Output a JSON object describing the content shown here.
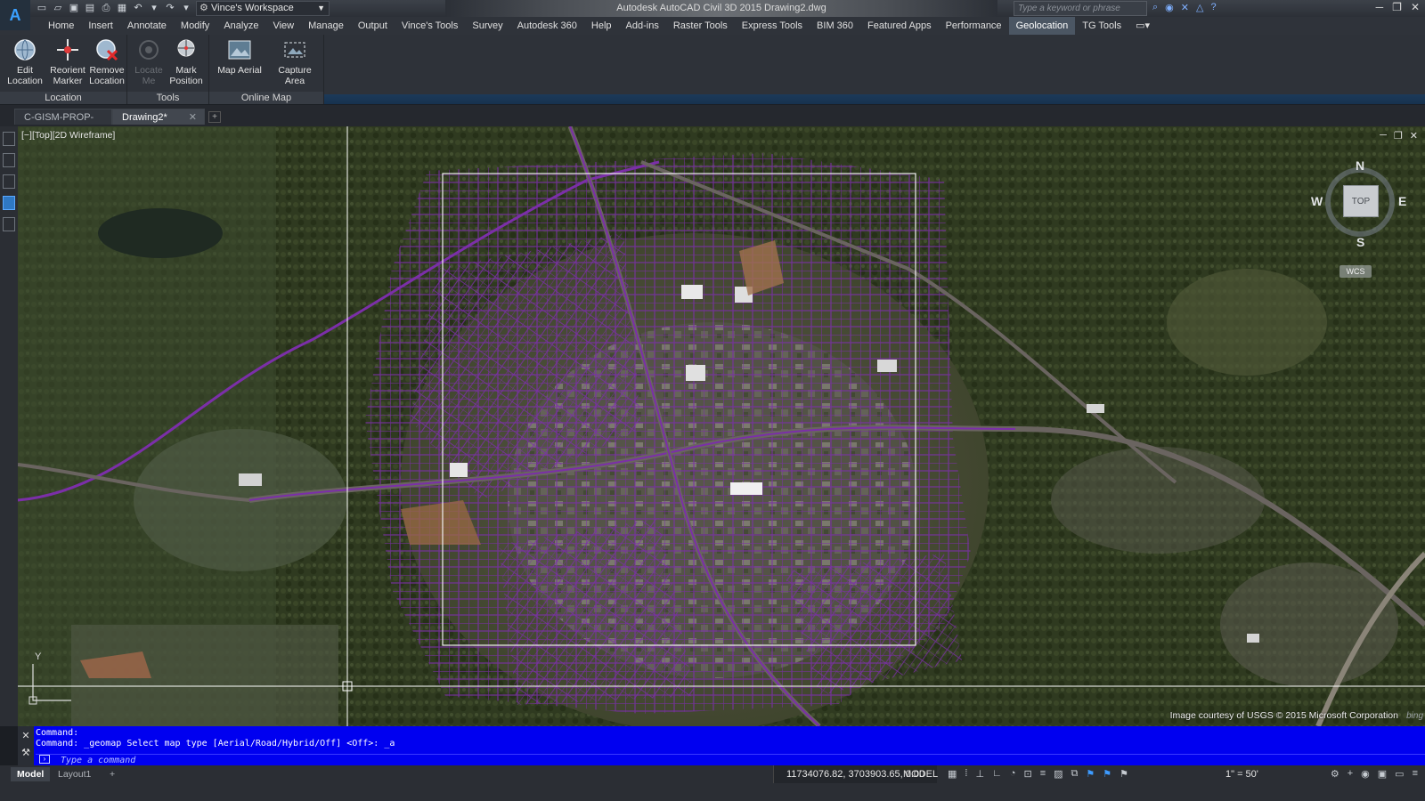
{
  "titlebar": {
    "app_logo_text": "A",
    "workspace": "Vince's Workspace",
    "title": "Autodesk AutoCAD Civil 3D 2015    Drawing2.dwg",
    "search_placeholder": "Type a keyword or phrase"
  },
  "menu": {
    "items": [
      "Home",
      "Insert",
      "Annotate",
      "Modify",
      "Analyze",
      "View",
      "Manage",
      "Output",
      "Vince's Tools",
      "Survey",
      "Autodesk 360",
      "Help",
      "Add-ins",
      "Raster Tools",
      "Express Tools",
      "BIM 360",
      "Featured Apps",
      "Performance",
      "Geolocation",
      "TG Tools"
    ],
    "active": "Geolocation"
  },
  "ribbon": {
    "panels": [
      {
        "title": "Location",
        "buttons": [
          {
            "label": "Edit Location"
          },
          {
            "label": "Reorient Marker"
          },
          {
            "label": "Remove Location"
          }
        ]
      },
      {
        "title": "Tools",
        "buttons": [
          {
            "label": "Locate Me",
            "disabled": true
          },
          {
            "label": "Mark Position"
          }
        ]
      },
      {
        "title": "Online Map",
        "buttons": [
          {
            "label": "Map Aerial"
          },
          {
            "label": "Capture Area"
          }
        ]
      }
    ]
  },
  "doc_tabs": [
    {
      "label": "C-GISM-PROP-E*",
      "active": false
    },
    {
      "label": "Drawing2*",
      "active": true
    }
  ],
  "viewport": {
    "label": "[−][Top][2D Wireframe]",
    "viewcube": {
      "top": "TOP",
      "n": "N",
      "s": "S",
      "e": "E",
      "w": "W"
    },
    "wcs": "WCS",
    "attribution": "Image courtesy of USGS © 2015 Microsoft Corporation",
    "bing": "bing",
    "ucs_y": "Y"
  },
  "command": {
    "history": [
      "Command:",
      "Command: _geomap Select map type [Aerial/Road/Hybrid/Off] <Off>: _a"
    ],
    "placeholder": "Type a command"
  },
  "status": {
    "layout_tabs": [
      "Model",
      "Layout1"
    ],
    "coords": "11734076.82, 3703903.65, 0.00",
    "model": "MODEL",
    "scale": "1\" = 50'"
  },
  "colors": {
    "parcel_lines": "#7b2fa8",
    "command_bg": "#0000f0",
    "accent": "#4b5663"
  }
}
